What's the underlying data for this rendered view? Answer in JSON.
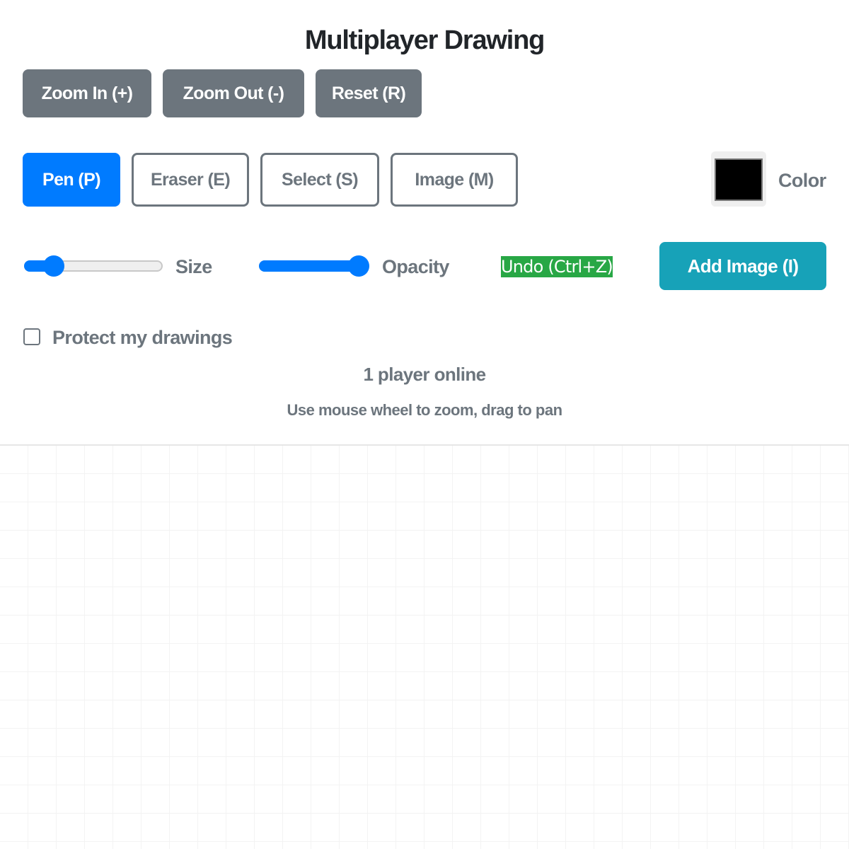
{
  "title": "Multiplayer Drawing",
  "view_controls": {
    "zoom_in": "Zoom In (+)",
    "zoom_out": "Zoom Out (-)",
    "reset": "Reset (R)"
  },
  "tools": {
    "pen": "Pen (P)",
    "eraser": "Eraser (E)",
    "select": "Select (S)",
    "image": "Image (M)",
    "active": "pen"
  },
  "color": {
    "label": "Color",
    "value": "#000000"
  },
  "size": {
    "label": "Size",
    "value_fraction": 0.16
  },
  "opacity": {
    "label": "Opacity",
    "value_fraction": 1.0
  },
  "undo_label": "Undo (Ctrl+Z)",
  "add_image_label": "Add Image (I)",
  "protect": {
    "label": "Protect my drawings",
    "checked": false
  },
  "players_online": "1 player online",
  "hint": "Use mouse wheel to zoom, drag to pan",
  "colors": {
    "primary": "#007bff",
    "secondary": "#6c757d",
    "info": "#17a2b8",
    "success": "#28a745"
  }
}
